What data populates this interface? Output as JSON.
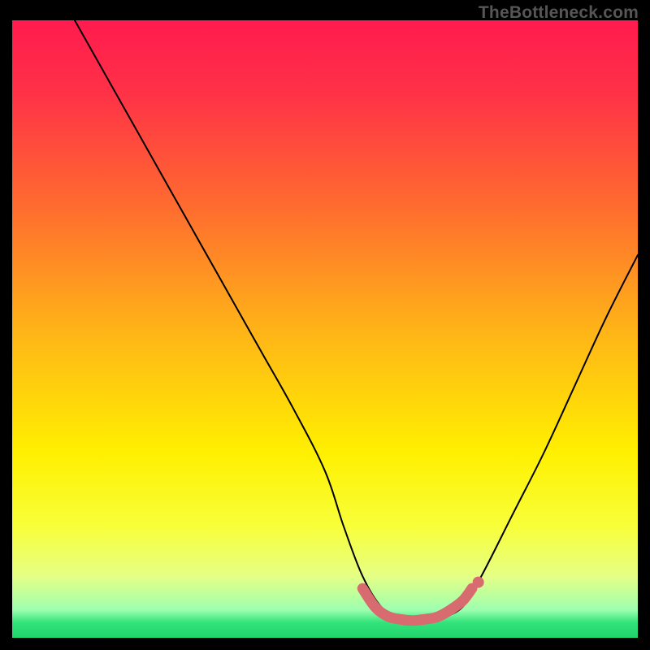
{
  "watermark": "TheBottleneck.com",
  "gradient": {
    "stops": [
      {
        "offset": 0.0,
        "color": "#ff1b4e"
      },
      {
        "offset": 0.12,
        "color": "#ff3247"
      },
      {
        "offset": 0.3,
        "color": "#ff6b2f"
      },
      {
        "offset": 0.5,
        "color": "#ffb318"
      },
      {
        "offset": 0.7,
        "color": "#fff000"
      },
      {
        "offset": 0.82,
        "color": "#f8ff3a"
      },
      {
        "offset": 0.9,
        "color": "#e5ff85"
      },
      {
        "offset": 0.955,
        "color": "#9dffb0"
      },
      {
        "offset": 0.975,
        "color": "#33e37b"
      },
      {
        "offset": 1.0,
        "color": "#1fd46a"
      }
    ]
  },
  "chart_data": {
    "type": "line",
    "title": "",
    "xlabel": "",
    "ylabel": "",
    "x_range": [
      0,
      100
    ],
    "y_range": [
      0,
      100
    ],
    "series": [
      {
        "name": "bottleneck-curve",
        "x": [
          10,
          15,
          20,
          25,
          30,
          35,
          40,
          45,
          50,
          53,
          56,
          59,
          62,
          65,
          68,
          72,
          75,
          80,
          85,
          90,
          95,
          100
        ],
        "y": [
          100,
          91,
          82,
          73,
          64,
          55,
          46,
          37,
          27,
          18,
          10,
          5,
          3,
          2.5,
          3,
          5,
          10,
          20,
          30,
          41,
          52,
          62
        ]
      }
    ],
    "highlight": {
      "name": "optimal-zone",
      "x": [
        56,
        58,
        60,
        62,
        64,
        66,
        68,
        70,
        72,
        73.5
      ],
      "y": [
        8,
        5,
        3.5,
        3,
        2.8,
        3,
        3.4,
        4.5,
        6,
        8
      ]
    },
    "highlight_point": {
      "x": 74.5,
      "y": 9
    }
  }
}
